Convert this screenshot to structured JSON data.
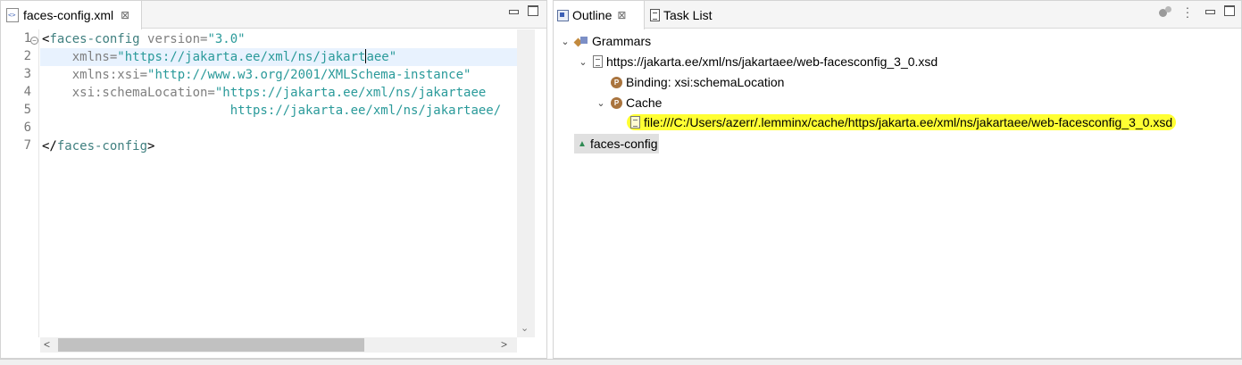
{
  "editor": {
    "tab_label": "faces-config.xml",
    "tab_close": "⊠",
    "line_numbers": [
      "1",
      "2",
      "3",
      "4",
      "5",
      "6",
      "7"
    ],
    "lines": {
      "l1": {
        "open": "<",
        "tag": "faces-config",
        "attr": " version=",
        "val": "\"3.0\""
      },
      "l2": {
        "indent": "    ",
        "attr": "xmlns=",
        "val_before_caret": "\"https://jakarta.ee/xml/ns/jakart",
        "val_after_caret": "aee\""
      },
      "l3": {
        "indent": "    ",
        "attr": "xmlns:xsi=",
        "val": "\"http://www.w3.org/2001/XMLSchema-instance\""
      },
      "l4": {
        "indent": "    ",
        "attr": "xsi:schemaLocation=",
        "val": "\"https://jakarta.ee/xml/ns/jakartaee"
      },
      "l5": {
        "indent": "                         ",
        "val": "https://jakarta.ee/xml/ns/jakartaee/"
      },
      "l7": {
        "open": "</",
        "tag": "faces-config",
        "close": ">"
      }
    },
    "scroll_arrow_down": "⌄",
    "scroll_arrow_left": "<",
    "scroll_arrow_right": ">"
  },
  "outline": {
    "tabs": {
      "outline_label": "Outline",
      "outline_close": "⊠",
      "tasklist_label": "Task List"
    },
    "tree": {
      "grammars": "Grammars",
      "schema_url": "https://jakarta.ee/xml/ns/jakartaee/web-facesconfig_3_0.xsd",
      "binding": "Binding: xsi:schemaLocation",
      "cache": "Cache",
      "cache_file": "file:///C:/Users/azerr/.lemminx/cache/https/jakarta.ee/xml/ns/jakartaee/web-facesconfig_3_0.xsd",
      "root_element": "faces-config",
      "expand_glyph": "⌄",
      "p_glyph": "P",
      "elem_glyph": "▲"
    }
  },
  "colors": {
    "highlight": "#ffff33",
    "tag": "#3f7f7f",
    "attribute": "#7f7f7f",
    "value": "#2a9a9a"
  }
}
